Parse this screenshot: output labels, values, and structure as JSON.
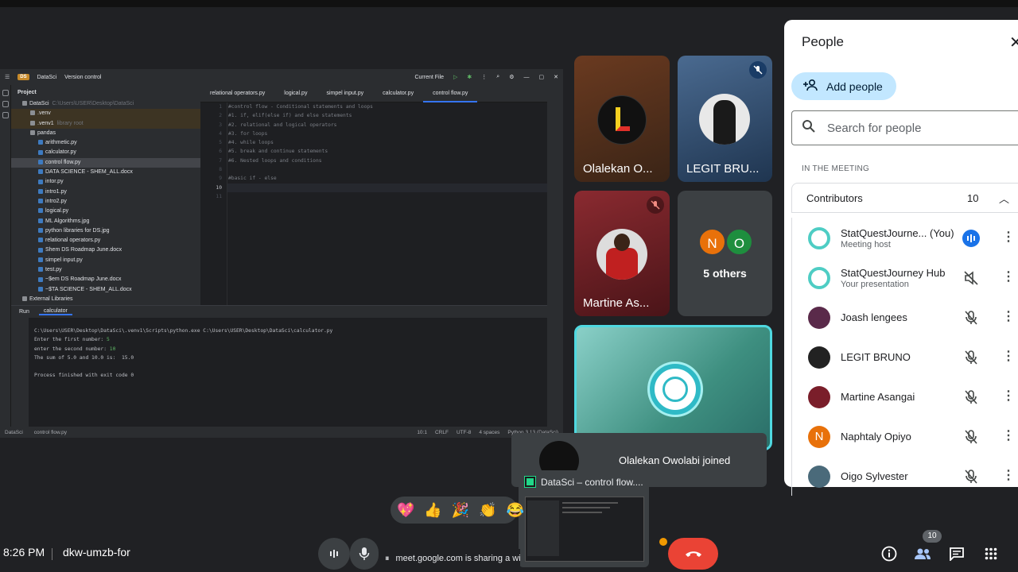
{
  "ide": {
    "project_name": "DataSci",
    "version_control": "Version control",
    "run_config": "Current File",
    "project_label": "Project",
    "tree": [
      {
        "label": "DataSci",
        "sub": "C:\\Users\\USER\\Desktop\\DataSci",
        "indent": 1
      },
      {
        "label": ".venv",
        "sub": "",
        "indent": 2
      },
      {
        "label": ".venv1",
        "sub": "library root",
        "indent": 2
      },
      {
        "label": "pandas",
        "sub": "",
        "indent": 2
      },
      {
        "label": "arithmetic.py",
        "sub": "",
        "indent": 3
      },
      {
        "label": "calculator.py",
        "sub": "",
        "indent": 3
      },
      {
        "label": "control flow.py",
        "sub": "",
        "indent": 3
      },
      {
        "label": "DATA SCIENCE - SHEM_ALL.docx",
        "sub": "",
        "indent": 3
      },
      {
        "label": "intor.py",
        "sub": "",
        "indent": 3
      },
      {
        "label": "intro1.py",
        "sub": "",
        "indent": 3
      },
      {
        "label": "intro2.py",
        "sub": "",
        "indent": 3
      },
      {
        "label": "logical.py",
        "sub": "",
        "indent": 3
      },
      {
        "label": "ML Algorithms.jpg",
        "sub": "",
        "indent": 3
      },
      {
        "label": "python libraries for DS.jpg",
        "sub": "",
        "indent": 3
      },
      {
        "label": "relational operators.py",
        "sub": "",
        "indent": 3
      },
      {
        "label": "Shem DS Roadmap June.docx",
        "sub": "",
        "indent": 3
      },
      {
        "label": "simpel input.py",
        "sub": "",
        "indent": 3
      },
      {
        "label": "test.py",
        "sub": "",
        "indent": 3
      },
      {
        "label": "~$em DS Roadmap June.docx",
        "sub": "",
        "indent": 3
      },
      {
        "label": "~$TA SCIENCE - SHEM_ALL.docx",
        "sub": "",
        "indent": 3
      },
      {
        "label": "External Libraries",
        "sub": "",
        "indent": 1
      }
    ],
    "tabs": [
      "relational operators.py",
      "logical.py",
      "simpel input.py",
      "calculator.py",
      "control flow.py"
    ],
    "code_lines": [
      "#control flow - Conditional statements and loops",
      "#1. if, elif(else if) and else statements",
      "#2. relational and logical operators",
      "#3. for loops",
      "#4. while loops",
      "#5. break and continue statements",
      "#6. Nested loops and conditions",
      "",
      "#basic if - else",
      "",
      ""
    ],
    "line_numbers": [
      "1",
      "2",
      "3",
      "4",
      "5",
      "6",
      "7",
      "8",
      "9",
      "10",
      "11"
    ],
    "run_label": "Run",
    "run_tab": "calculator",
    "console": [
      {
        "text": "C:\\Users\\USER\\Desktop\\DataSci\\.venv1\\Scripts\\python.exe C:\\Users\\USER\\Desktop\\DataSci\\calculator.py",
        "input": ""
      },
      {
        "text": "Enter the first number: ",
        "input": "5"
      },
      {
        "text": "enter the second number: ",
        "input": "10"
      },
      {
        "text": "The sum of 5.0 and 10.0 is:  15.0",
        "input": ""
      },
      {
        "text": "",
        "input": ""
      },
      {
        "text": "Process finished with exit code 0",
        "input": ""
      }
    ],
    "status": {
      "breadcrumb_project": "DataSci",
      "breadcrumb_file": "control flow.py",
      "position": "10:1",
      "line_sep": "CRLF",
      "encoding": "UTF-8",
      "indent": "4 spaces",
      "interpreter": "Python 3.13 (DataSci)"
    }
  },
  "tiles": [
    {
      "name": "Olalekan O...",
      "muted": false,
      "bg": "#4a2c1c"
    },
    {
      "name": "LEGIT BRU...",
      "muted": true,
      "bg": "#2f4a6a"
    },
    {
      "name": "Martine As...",
      "muted": true,
      "bg": "#6a1e26"
    },
    {
      "name": "5 others",
      "muted": false,
      "bg": "#3c4043",
      "initials": [
        "N",
        "O"
      ]
    }
  ],
  "people_panel": {
    "title": "People",
    "add_people": "Add people",
    "search_placeholder": "Search for people",
    "section": "IN THE MEETING",
    "group": "Contributors",
    "count": "10",
    "members": [
      {
        "name": "StatQuestJourne...  (You)",
        "sub": "Meeting host",
        "mic": "speaking",
        "color": "#e8f5f4"
      },
      {
        "name": "StatQuestJourney Hub",
        "sub": "Your presentation",
        "mic": "presenting",
        "color": "#e8f5f4"
      },
      {
        "name": "Joash lengees",
        "sub": "",
        "mic": "muted",
        "color": "#5a2a4a"
      },
      {
        "name": "LEGIT BRUNO",
        "sub": "",
        "mic": "muted",
        "color": "#222222"
      },
      {
        "name": "Martine Asangai",
        "sub": "",
        "mic": "muted",
        "color": "#7a1e2a"
      },
      {
        "name": "Naphtaly Opiyo",
        "sub": "",
        "mic": "muted",
        "color": "#e8710a",
        "initial": "N"
      },
      {
        "name": "Oigo Sylvester",
        "sub": "",
        "mic": "muted",
        "color": "#4a6a7a"
      }
    ]
  },
  "notification": {
    "text": "Olalekan Owolabi joined"
  },
  "share_window": {
    "title": "DataSci – control flow...."
  },
  "reactions": [
    "💖",
    "👍",
    "🎉",
    "👏",
    "😂"
  ],
  "bottom": {
    "time": "8:26 PM",
    "meeting_code": "dkw-umzb-for",
    "sharing_text": "meet.google.com is sharing a wi",
    "participants_badge": "10"
  }
}
